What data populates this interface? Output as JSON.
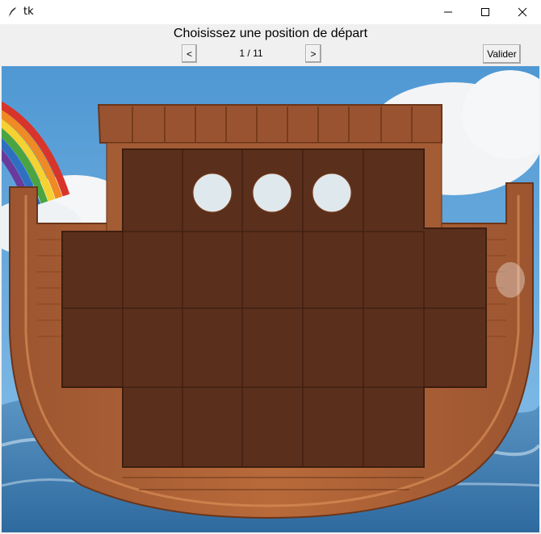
{
  "window": {
    "title": "tk",
    "minimize_icon": "minimize-icon",
    "maximize_icon": "maximize-icon",
    "close_icon": "close-icon",
    "app_icon": "feather-icon"
  },
  "header": {
    "prompt": "Choisissez une position de départ"
  },
  "navigation": {
    "prev_label": "<",
    "next_label": ">",
    "counter": "1 / 11",
    "current": 1,
    "total": 11
  },
  "actions": {
    "validate_label": "Valider"
  },
  "board": {
    "image": "noah-ark-board",
    "colors": {
      "sky": "#5fa6dc",
      "ark_outer": "#b8693a",
      "ark_board": "#5a2f1c",
      "water": "#3f7fb5"
    }
  }
}
